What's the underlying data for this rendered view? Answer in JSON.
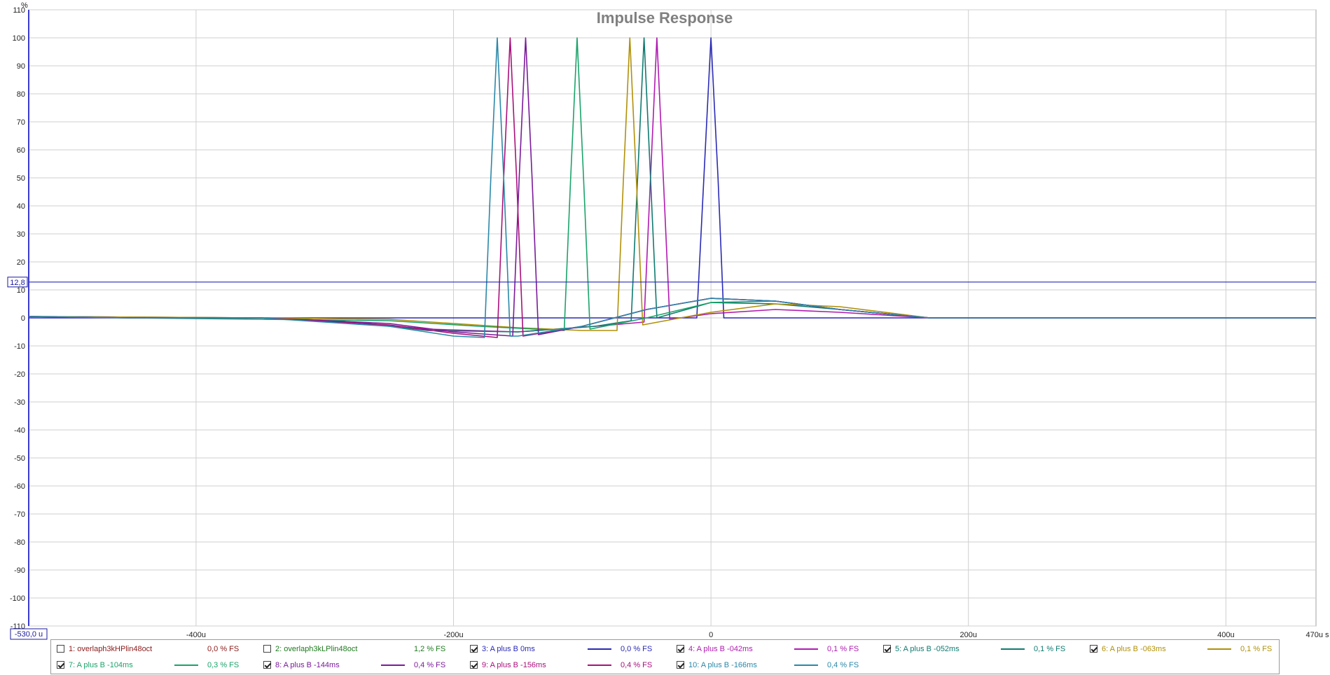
{
  "chart_data": {
    "type": "line",
    "title": "Impulse Response",
    "y_unit": "%",
    "x_unit": "s",
    "xlim": [
      -0.00053,
      0.00047
    ],
    "ylim": [
      -110,
      110
    ],
    "x_range_start_label": "-530,0 u",
    "x_range_end_label": "470u s",
    "cursor_value": 12.8,
    "cursor_label": "12,8",
    "grid": true,
    "legend_position": "bottom",
    "y_ticks": [
      {
        "v": 110,
        "label": "110"
      },
      {
        "v": 100,
        "label": "100"
      },
      {
        "v": 90,
        "label": "90"
      },
      {
        "v": 80,
        "label": "80"
      },
      {
        "v": 70,
        "label": "70"
      },
      {
        "v": 60,
        "label": "60"
      },
      {
        "v": 50,
        "label": "50"
      },
      {
        "v": 40,
        "label": "40"
      },
      {
        "v": 30,
        "label": "30"
      },
      {
        "v": 20,
        "label": "20"
      },
      {
        "v": 10,
        "label": "10"
      },
      {
        "v": 0,
        "label": "0"
      },
      {
        "v": -10,
        "label": "-10"
      },
      {
        "v": -20,
        "label": "-20"
      },
      {
        "v": -30,
        "label": "-30"
      },
      {
        "v": -40,
        "label": "-40"
      },
      {
        "v": -50,
        "label": "-50"
      },
      {
        "v": -60,
        "label": "-60"
      },
      {
        "v": -70,
        "label": "-70"
      },
      {
        "v": -80,
        "label": "-80"
      },
      {
        "v": -90,
        "label": "-90"
      },
      {
        "v": -100,
        "label": "-100"
      },
      {
        "v": -110,
        "label": "-110"
      }
    ],
    "x_ticks": [
      {
        "v": -0.0004,
        "label": "-400u"
      },
      {
        "v": -0.0002,
        "label": "-200u"
      },
      {
        "v": 0,
        "label": "0"
      },
      {
        "v": 0.0002,
        "label": "200u"
      },
      {
        "v": 0.0004,
        "label": "400u"
      }
    ],
    "series": [
      {
        "name": "1: overlaph3kHPlin48oct",
        "value_label": "0,0 % FS",
        "color": "#8b1a1a",
        "checked": false,
        "x": [],
        "y": []
      },
      {
        "name": "2: overlaph3kLPlin48oct",
        "value_label": "1,2 % FS",
        "color": "#1f7a1f",
        "checked": false,
        "x": [],
        "y": []
      },
      {
        "name": "3: A plus B 0ms",
        "value_label": "0,0 % FS",
        "color": "#2a2ab5",
        "checked": true,
        "x": [
          -0.00053,
          -0.00035,
          -9e-05,
          -1.1e-05,
          -5.5e-06,
          0,
          5.5e-06,
          1e-05,
          0.0001,
          0.00047
        ],
        "y": [
          0,
          0,
          0,
          0,
          50,
          100,
          50,
          0,
          0,
          0
        ]
      },
      {
        "name": "4: A plus B -042ms",
        "value_label": "0,1 % FS",
        "color": "#b01ab0",
        "checked": true,
        "x": [
          -0.00053,
          -0.00035,
          -0.00029,
          -0.00022,
          -0.00015,
          -9e-05,
          -5.2e-05,
          -4.7e-05,
          -4.2e-05,
          -3.7e-05,
          -3.2e-05,
          0,
          5e-05,
          0.0001,
          0.00017,
          0.00047
        ],
        "y": [
          0.5,
          0,
          -1,
          -4,
          -5,
          -3,
          -1.5,
          50,
          100,
          50,
          -0.5,
          1.5,
          3,
          2,
          0,
          0
        ]
      },
      {
        "name": "5: A plus B -052ms",
        "value_label": "0,1 % FS",
        "color": "#0f7a70",
        "checked": true,
        "x": [
          -0.00053,
          -0.00035,
          -0.00029,
          -0.00022,
          -0.00015,
          -9e-05,
          -6.2e-05,
          -5.7e-05,
          -5.2e-05,
          -4.7e-05,
          -4.2e-05,
          0,
          5e-05,
          0.0001,
          0.00017,
          0.00047
        ],
        "y": [
          0.5,
          0,
          -1,
          -4.5,
          -5,
          -3,
          -1,
          50,
          100,
          50,
          0,
          5.5,
          5,
          3,
          0,
          0
        ]
      },
      {
        "name": "6: A plus B -063ms",
        "value_label": "0,1 % FS",
        "color": "#b0900a",
        "checked": true,
        "x": [
          -0.00053,
          -0.00035,
          -0.00025,
          -0.00015,
          -0.0001,
          -7.3e-05,
          -6.8e-05,
          -6.3e-05,
          -5.8e-05,
          -5.3e-05,
          0,
          5e-05,
          0.0001,
          0.00017,
          0.00047
        ],
        "y": [
          0.5,
          0,
          -0.5,
          -3.5,
          -4.5,
          -4.5,
          50,
          100,
          50,
          -2.5,
          2,
          5,
          4,
          0,
          0
        ]
      },
      {
        "name": "7: A plus B -104ms",
        "value_label": "0,3 % FS",
        "color": "#1aa36a",
        "checked": true,
        "x": [
          -0.00053,
          -0.00045,
          -0.00035,
          -0.00025,
          -0.00018,
          -0.000114,
          -0.000109,
          -0.000104,
          -9.9e-05,
          -9.4e-05,
          -5e-05,
          0,
          5e-05,
          0.0001,
          0.00017,
          0.00047
        ],
        "y": [
          0.5,
          0,
          -0.5,
          -1,
          -3,
          -4.5,
          50,
          100,
          50,
          -4,
          0,
          5.5,
          6,
          3,
          0,
          0
        ]
      },
      {
        "name": "8: A plus B -144ms",
        "value_label": "0,4 % FS",
        "color": "#7a1a9a",
        "checked": true,
        "x": [
          -0.00053,
          -0.00045,
          -0.00035,
          -0.00025,
          -0.0002,
          -0.000154,
          -0.000149,
          -0.000144,
          -0.000139,
          -0.000134,
          -0.0001,
          -5e-05,
          0,
          5e-05,
          0.0001,
          0.00017,
          0.00047
        ],
        "y": [
          0.5,
          0,
          0,
          -2,
          -5,
          -6.5,
          50,
          100,
          50,
          -6,
          -3,
          3,
          7,
          6,
          3,
          0,
          0
        ]
      },
      {
        "name": "9: A plus B -156ms",
        "value_label": "0,4 % FS",
        "color": "#a8107a",
        "checked": true,
        "x": [
          -0.00053,
          -0.00045,
          -0.00035,
          -0.00025,
          -0.0002,
          -0.000166,
          -0.000161,
          -0.000156,
          -0.000151,
          -0.000146,
          -0.0001,
          -5e-05,
          0,
          5e-05,
          0.0001,
          0.00017,
          0.00047
        ],
        "y": [
          0.5,
          0,
          0,
          -2.5,
          -5.5,
          -7,
          50,
          100,
          50,
          -6.5,
          -3,
          3,
          7,
          6,
          3,
          0,
          0
        ]
      },
      {
        "name": "10: A plus B -166ms",
        "value_label": "0,4 % FS",
        "color": "#2a88a8",
        "checked": true,
        "x": [
          -0.00053,
          -0.00045,
          -0.00035,
          -0.00025,
          -0.0002,
          -0.000176,
          -0.000171,
          -0.000166,
          -0.000161,
          -0.000156,
          -0.00015,
          -0.0001,
          -5e-05,
          0,
          5e-05,
          0.0001,
          0.00017,
          0.00047
        ],
        "y": [
          0.5,
          0,
          0,
          -3,
          -6.5,
          -7,
          50,
          100,
          50,
          -6.5,
          -6.5,
          -3,
          3,
          7,
          6,
          3,
          0,
          0
        ]
      }
    ]
  }
}
